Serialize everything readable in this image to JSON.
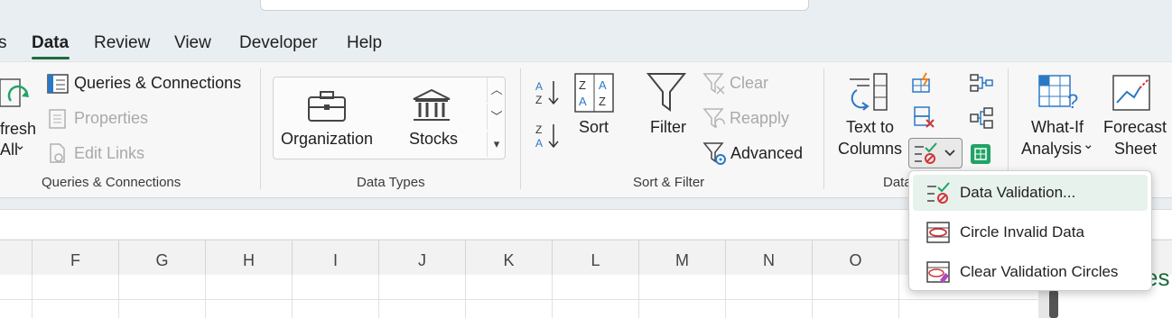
{
  "tabs": {
    "partial_left": "s",
    "data": "Data",
    "review": "Review",
    "view": "View",
    "developer": "Developer",
    "help": "Help"
  },
  "ribbon": {
    "get_data": {
      "refresh_line1": "fresh",
      "refresh_line2": "All",
      "refresh_chevron": "⌄",
      "queries_connections": "Queries & Connections",
      "properties": "Properties",
      "edit_links": "Edit Links",
      "group_label": "Queries & Connections"
    },
    "data_types": {
      "organization": "Organization",
      "stocks": "Stocks",
      "group_label": "Data Types"
    },
    "sort_filter": {
      "sort": "Sort",
      "filter": "Filter",
      "clear": "Clear",
      "reapply": "Reapply",
      "advanced": "Advanced",
      "group_label": "Sort & Filter"
    },
    "data_tools": {
      "text_to_columns_line1": "Text to",
      "text_to_columns_line2": "Columns",
      "group_label_partial": "Data"
    },
    "forecast": {
      "what_if_line1": "What-If",
      "what_if_line2": "Analysis",
      "what_if_chevron": "⌄",
      "forecast_line1": "Forecast",
      "forecast_line2": "Sheet"
    }
  },
  "columns": [
    "F",
    "G",
    "H",
    "I",
    "J",
    "K",
    "L",
    "M",
    "N",
    "O"
  ],
  "dropdown": {
    "items": [
      {
        "label": "Data Validation...",
        "icon": "data-validation-icon",
        "highlighted": true
      },
      {
        "label": "Circle Invalid Data",
        "icon": "circle-invalid-data-icon",
        "highlighted": false
      },
      {
        "label": "Clear Validation Circles",
        "icon": "clear-validation-circles-icon",
        "highlighted": false
      }
    ]
  },
  "side_partial_text": "es",
  "colors": {
    "accent": "#1e6b3c",
    "icon_blue": "#2b78c5",
    "icon_red": "#d13438",
    "icon_orange": "#e8842a"
  }
}
